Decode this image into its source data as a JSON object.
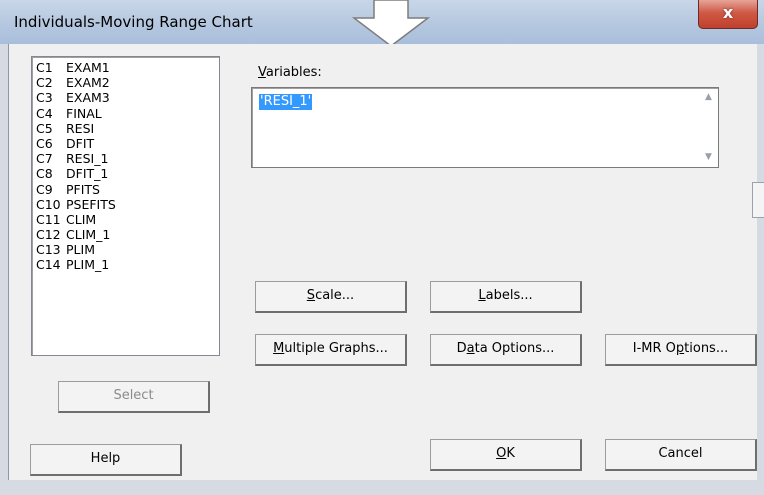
{
  "window": {
    "title": "Individuals-Moving Range Chart",
    "close_label": "x"
  },
  "columns": [
    {
      "code": "C1",
      "name": "EXAM1"
    },
    {
      "code": "C2",
      "name": "EXAM2"
    },
    {
      "code": "C3",
      "name": "EXAM3"
    },
    {
      "code": "C4",
      "name": "FINAL"
    },
    {
      "code": "C5",
      "name": "RESI"
    },
    {
      "code": "C6",
      "name": "DFIT"
    },
    {
      "code": "C7",
      "name": "RESI_1"
    },
    {
      "code": "C8",
      "name": "DFIT_1"
    },
    {
      "code": "C9",
      "name": "PFITS"
    },
    {
      "code": "C10",
      "name": "PSEFITS"
    },
    {
      "code": "C11",
      "name": "CLIM"
    },
    {
      "code": "C12",
      "name": "CLIM_1"
    },
    {
      "code": "C13",
      "name": "PLIM"
    },
    {
      "code": "C14",
      "name": "PLIM_1"
    }
  ],
  "variables": {
    "label_prefix": "V",
    "label_rest": "ariables:",
    "value": "'RESI_1'"
  },
  "buttons": {
    "scale": {
      "u": "S",
      "rest": "cale..."
    },
    "labels": {
      "u": "L",
      "rest": "abels..."
    },
    "multiple_graphs": {
      "u": "M",
      "rest": "ultiple Graphs..."
    },
    "data_options": {
      "pre": "D",
      "u": "a",
      "rest": "ta Options..."
    },
    "imr_options": {
      "pre": "I-MR O",
      "u": "p",
      "rest": "tions..."
    },
    "select": "Select",
    "help": "Help",
    "ok": {
      "u": "O",
      "rest": "K"
    },
    "cancel": "Cancel"
  }
}
